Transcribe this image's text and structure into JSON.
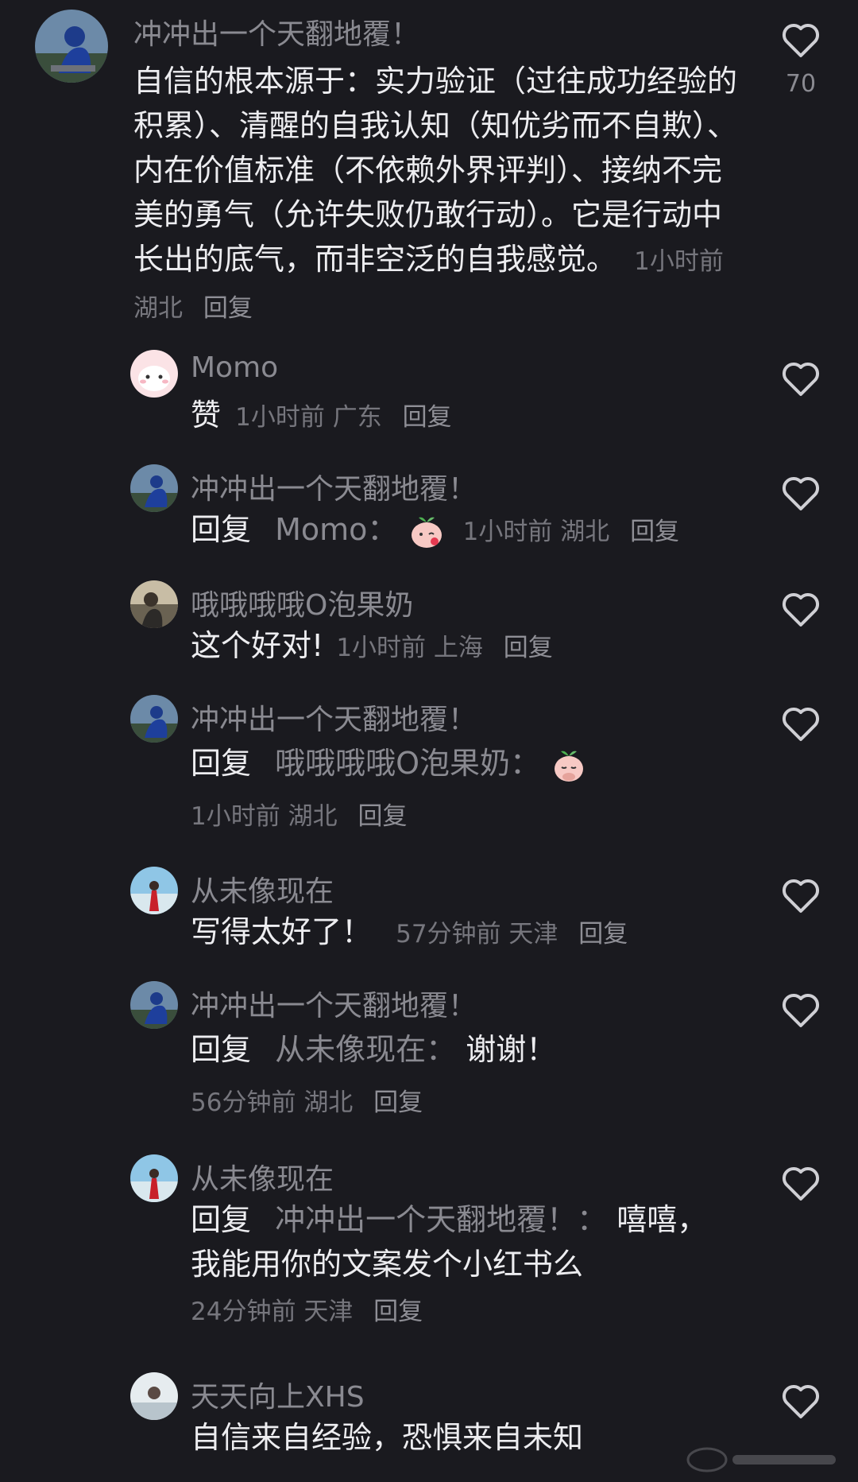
{
  "main": {
    "author": "冲冲出一个天翻地覆！",
    "text": "自信的根本源于：实力验证（过往成功经验的积累）、清醒的自我认知（知优劣而不自欺）、内在价值标准（不依赖外界评判）、接纳不完美的勇气（允许失败仍敢行动）。它是行动中长出的底气，而非空泛的自我感觉。",
    "time": "1小时前",
    "location": "湖北",
    "reply_label": "回复",
    "likes": "70"
  },
  "replies": [
    {
      "author": "Momo",
      "text": "赞",
      "time": "1小时前",
      "location": "广东",
      "reply_label": "回复"
    },
    {
      "author": "冲冲出一个天翻地覆！",
      "prefix": "回复",
      "target": "Momo：",
      "emoji": "peach-kiss-emoji",
      "time": "1小时前",
      "location": "湖北",
      "reply_label": "回复"
    },
    {
      "author": "哦哦哦哦O泡果奶",
      "text": "这个好对!",
      "time": "1小时前",
      "location": "上海",
      "reply_label": "回复"
    },
    {
      "author": "冲冲出一个天翻地覆！",
      "prefix": "回复",
      "target": "哦哦哦哦O泡果奶：",
      "emoji": "peach-bow-emoji",
      "time": "1小时前",
      "location": "湖北",
      "reply_label": "回复"
    },
    {
      "author": "从未像现在",
      "text": "写得太好了！",
      "time": "57分钟前",
      "location": "天津",
      "reply_label": "回复"
    },
    {
      "author": "冲冲出一个天翻地覆！",
      "prefix": "回复",
      "target": "从未像现在：",
      "text": "谢谢！",
      "time": "56分钟前",
      "location": "湖北",
      "reply_label": "回复"
    },
    {
      "author": "从未像现在",
      "prefix": "回复",
      "target": "冲冲出一个天翻地覆！：",
      "text": "嘻嘻，我能用你的文案发个小红书么",
      "time": "24分钟前",
      "location": "天津",
      "reply_label": "回复"
    },
    {
      "author": "天天向上XHS",
      "text": "自信来自经验，恐惧来自未知"
    }
  ],
  "icons": {
    "like": "heart-outline-icon"
  },
  "colors": {
    "background": "#1a1a1f",
    "text": "#ededf0",
    "muted": "#8a8a91"
  }
}
